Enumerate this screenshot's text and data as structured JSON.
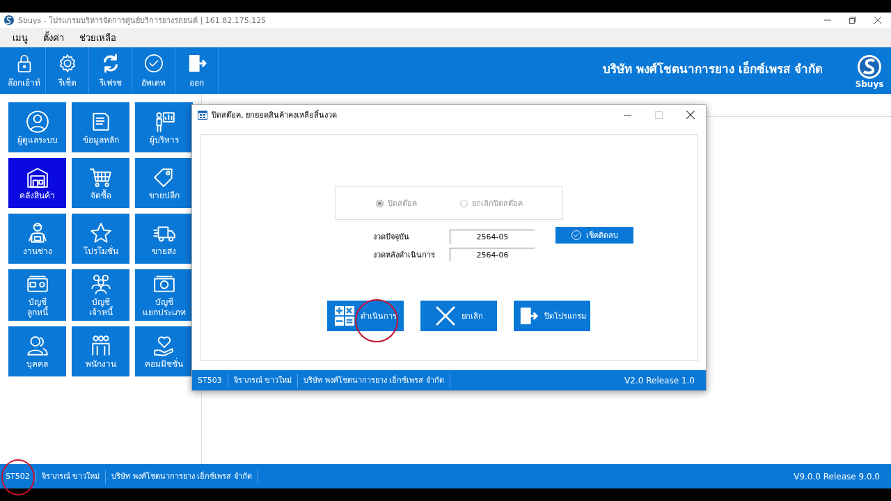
{
  "window": {
    "title": "Sbuys - โปรแกรมบริหารจัดการศูนย์บริการยางรถยนต์ | 161.82.175.125"
  },
  "menu": [
    "เมนู",
    "ตั้งค่า",
    "ช่วยเหลือ"
  ],
  "toolbar": [
    {
      "label": "ล๊อกเอ้าท์",
      "kind": "lock"
    },
    {
      "label": "รีเซ็ต",
      "kind": "gear"
    },
    {
      "label": "รีเฟรช",
      "kind": "refresh"
    },
    {
      "label": "อัพเดท",
      "kind": "check"
    },
    {
      "label": "ออก",
      "kind": "exit"
    }
  ],
  "header": {
    "company": "บริษัท พงศ์โชตนาการยาง เอ็กซ์เพรส จำกัด",
    "logo": "Sbuys"
  },
  "tiles": [
    {
      "lines": [
        "ผู้ดูแลระบบ"
      ],
      "kind": "person",
      "selected": false
    },
    {
      "lines": [
        "ข้อมูลหลัก"
      ],
      "kind": "folder",
      "selected": false
    },
    {
      "lines": [
        "ผู้บริหาร"
      ],
      "kind": "board",
      "selected": false
    },
    {
      "lines": [
        "คลังสินค้า"
      ],
      "kind": "warehouse",
      "selected": true
    },
    {
      "lines": [
        "จัดซื้อ"
      ],
      "kind": "cart",
      "selected": false
    },
    {
      "lines": [
        "ขายปลีก"
      ],
      "kind": "tag",
      "selected": false
    },
    {
      "lines": [
        "งานช่าง"
      ],
      "kind": "mechanic",
      "selected": false
    },
    {
      "lines": [
        "โปรโมชั่น"
      ],
      "kind": "star",
      "selected": false
    },
    {
      "lines": [
        "ขายส่ง"
      ],
      "kind": "truck",
      "selected": false
    },
    {
      "lines": [
        "บัญชี",
        "ลูกหนี้"
      ],
      "kind": "card",
      "selected": false
    },
    {
      "lines": [
        "บัญชี",
        "เจ้าหนี้"
      ],
      "kind": "group",
      "selected": false
    },
    {
      "lines": [
        "บัญชี",
        "แยกประเภท"
      ],
      "kind": "cash",
      "selected": false
    },
    {
      "lines": [
        "บุคคล"
      ],
      "kind": "people",
      "selected": false
    },
    {
      "lines": [
        "พนักงาน"
      ],
      "kind": "staff",
      "selected": false
    },
    {
      "lines": [
        "คอมมิชชั่น"
      ],
      "kind": "heart",
      "selected": false
    }
  ],
  "dialog": {
    "title": "ปิดสต๊อค, ยกยอดสินค้าคงเหลือสิ้นงวด",
    "options": [
      {
        "label": "ปิดสต๊อค",
        "selected": true,
        "disabled": true
      },
      {
        "label": "ยกเลิกปิดสต๊อค",
        "selected": false,
        "disabled": true
      }
    ],
    "fields": [
      {
        "label": "งวดปัจจุบัน",
        "value": "2564-05"
      },
      {
        "label": "งวดหลังดำเนินการ",
        "value": "2564-06"
      }
    ],
    "check_button": "เช็คติดลบ",
    "buttons": [
      {
        "label": "ดำเนินการ",
        "kind": "calc"
      },
      {
        "label": "ยกเลิก",
        "kind": "cancel"
      },
      {
        "label": "ปิดโปรแกรม",
        "kind": "exit"
      }
    ],
    "status_bar": {
      "cells": [
        "ST503",
        "จิราภรณ์ ขาวใหม่",
        "บริษัท พงศ์โชตนาการยาง เอ็กซ์เพรส จำกัด"
      ],
      "version": "V2.0 Release 1.0"
    }
  },
  "status_bar": {
    "cells": [
      "ST502",
      "จิราภรณ์ ขาวใหม่",
      "บริษัท พงศ์โชตนาการยาง เอ็กซ์เพรส จำกัด"
    ],
    "version": "V9.0.0 Release 9.0.0"
  }
}
